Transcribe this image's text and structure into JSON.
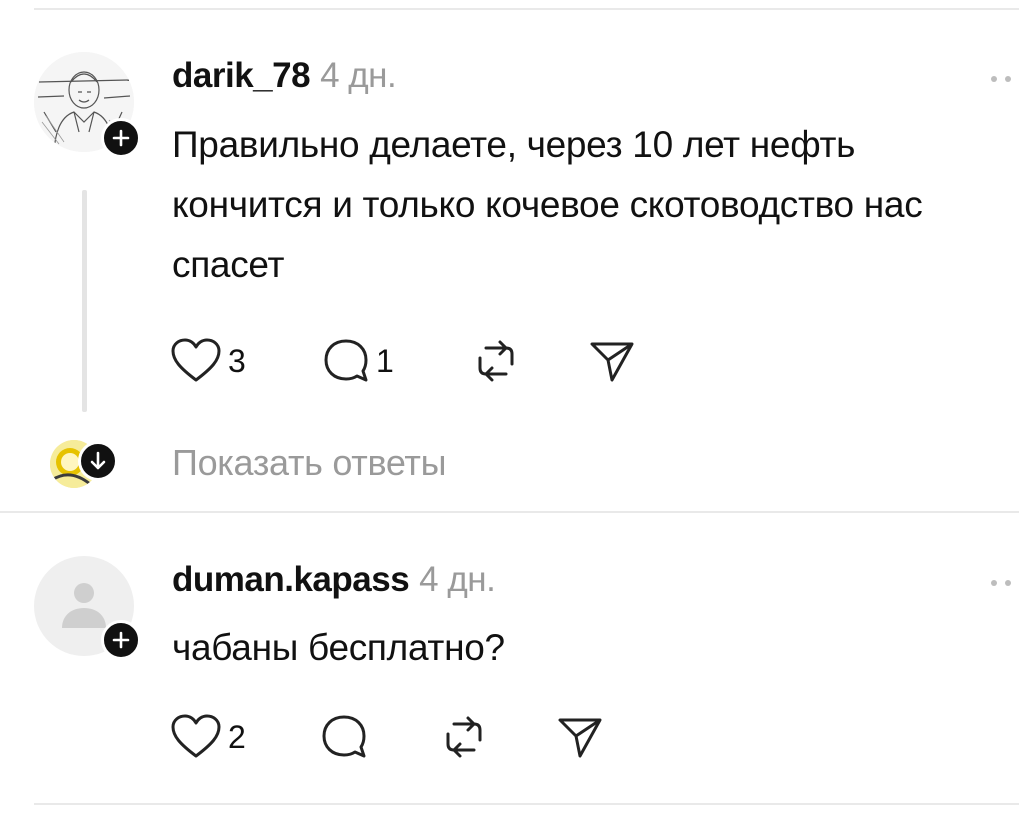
{
  "comments": [
    {
      "username": "darik_78",
      "age": "4 дн.",
      "text": "Правильно делаете, через 10 лет нефть кончится и только кочевое скотоводство нас спасет",
      "likes": "3",
      "replies": "1",
      "show_replies_label": "Показать ответы"
    },
    {
      "username": "duman.kapass",
      "age": "4 дн.",
      "text": "чабаны бесплатно?",
      "likes": "2",
      "replies": ""
    }
  ],
  "icons": {
    "like": "heart-outline-icon",
    "reply": "speech-bubble-icon",
    "repost": "repost-icon",
    "share": "paper-plane-icon",
    "more": "more-dots-icon",
    "follow": "plus-icon",
    "expand": "arrow-down-icon"
  }
}
